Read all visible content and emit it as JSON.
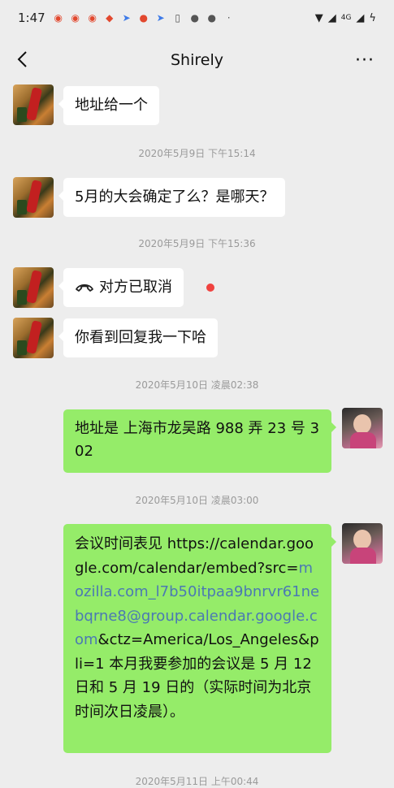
{
  "status_bar": {
    "time": "1:47",
    "signal_text": "4G"
  },
  "header": {
    "title": "Shirely",
    "more_label": "···"
  },
  "messages": [
    {
      "side": "left",
      "text": "地址给一个"
    },
    {
      "type": "timestamp",
      "text": "2020年5月9日 下午15:14"
    },
    {
      "side": "left",
      "text": "5月的大会确定了么？是哪天？"
    },
    {
      "type": "timestamp",
      "text": "2020年5月9日 下午15:36"
    },
    {
      "side": "left",
      "text": "对方已取消",
      "kind": "call"
    },
    {
      "side": "left",
      "text": "你看到回复我一下哈"
    },
    {
      "type": "timestamp",
      "text": "2020年5月10日 凌晨02:38"
    },
    {
      "side": "right",
      "text": "地址是 上海市龙吴路 988 弄 23 号 302"
    },
    {
      "type": "timestamp",
      "text": "2020年5月10日 凌晨03:00"
    },
    {
      "side": "right",
      "text_before": "会议时间表见 https://calendar.google.com/calendar/embed?src=",
      "link": "mozilla.com_l7b50itpaa9bnrvr61nebqrne8@group.calendar.google.com",
      "text_after": "&ctz=America/Los_Angeles&pli=1 本月我要参加的会议是 5 月 12 日和 5 月 19 日的（实际时间为北京时间次日凌晨）。"
    },
    {
      "type": "timestamp",
      "text": "2020年5月11日 上午00:44"
    }
  ]
}
